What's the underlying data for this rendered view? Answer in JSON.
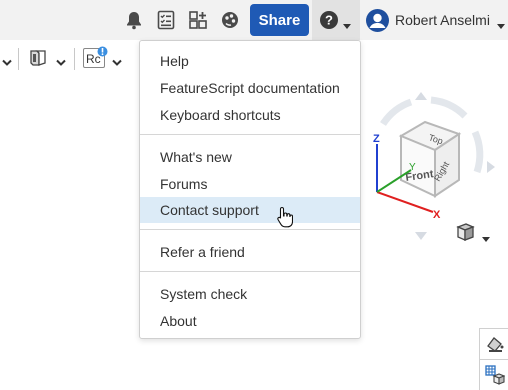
{
  "header": {
    "share_label": "Share",
    "user_name": "Robert Anselmi"
  },
  "toolbar": {
    "part_badge": "Rc"
  },
  "help_menu": {
    "items": [
      {
        "label": "Help"
      },
      {
        "label": "FeatureScript documentation"
      },
      {
        "label": "Keyboard shortcuts"
      },
      {
        "label": "What's new"
      },
      {
        "label": "Forums"
      },
      {
        "label": "Contact support",
        "highlighted": true
      },
      {
        "label": "Refer a friend"
      },
      {
        "label": "System check"
      },
      {
        "label": "About"
      }
    ]
  },
  "view_cube": {
    "face_top": "Top",
    "face_front": "Front",
    "face_right": "Right",
    "axis_x": "X",
    "axis_y": "Y",
    "axis_z": "Z"
  },
  "colors": {
    "share_button": "#1f5ab5",
    "menu_highlight": "#dcebf7",
    "axis_x": "#e02020",
    "axis_y": "#2aa02a",
    "axis_z": "#2040d0"
  }
}
